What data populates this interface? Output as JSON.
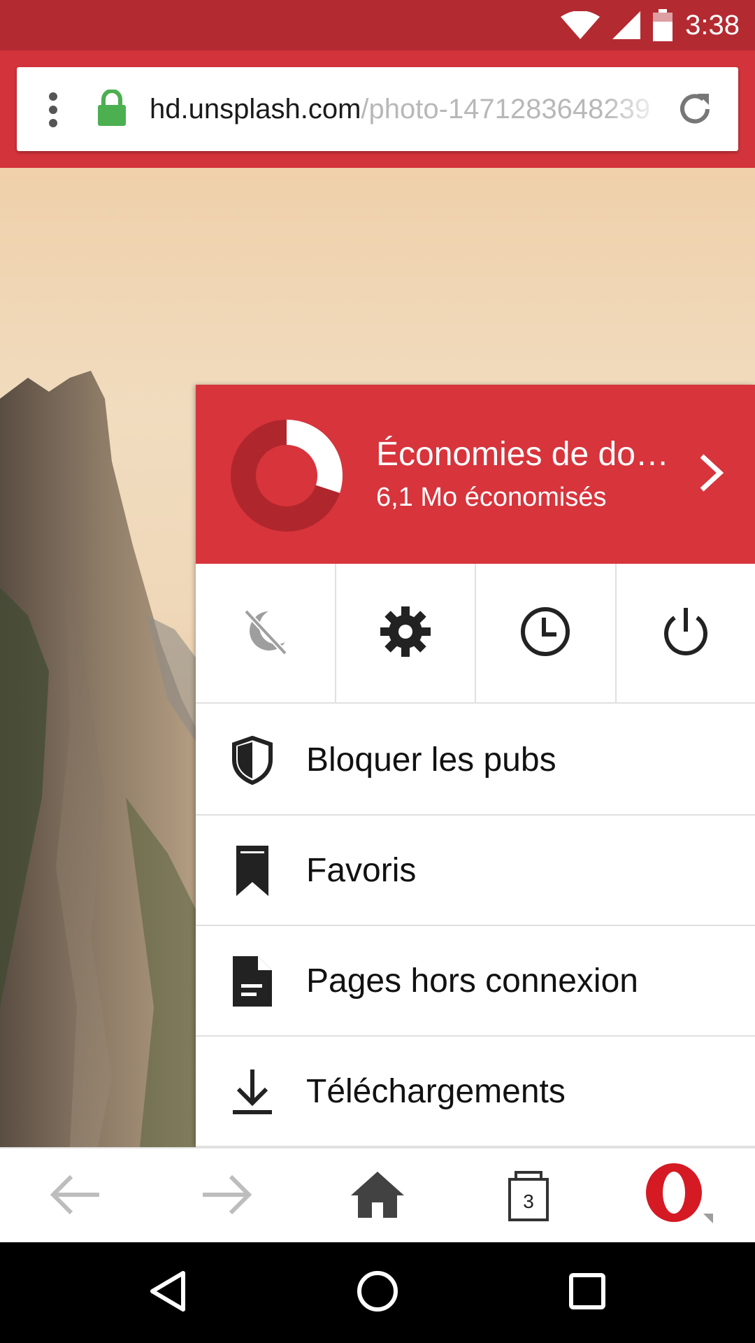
{
  "status_bar": {
    "time": "3:38",
    "icons": [
      "wifi-icon",
      "signal-icon",
      "battery-icon"
    ]
  },
  "address_bar": {
    "url_host": "hd.unsplash.com",
    "url_path": "/photo-1471283648239",
    "secure": true,
    "icons": [
      "menu-dots-icon",
      "lock-icon",
      "reload-icon"
    ]
  },
  "menu": {
    "savings": {
      "title": "Économies de do…",
      "subtitle": "6,1 Mo économisés",
      "progress_fraction": 0.3
    },
    "quick_actions": [
      {
        "icon": "night-mode-icon"
      },
      {
        "icon": "settings-gear-icon"
      },
      {
        "icon": "history-clock-icon"
      },
      {
        "icon": "power-exit-icon"
      }
    ],
    "items": [
      {
        "label": "Bloquer les pubs",
        "icon": "ad-block-shield-icon"
      },
      {
        "label": "Favoris",
        "icon": "bookmark-icon"
      },
      {
        "label": "Pages hors connexion",
        "icon": "offline-page-icon"
      },
      {
        "label": "Téléchargements",
        "icon": "download-icon"
      }
    ]
  },
  "bottom_bar": {
    "tab_count": "3",
    "icons": [
      "back-arrow-icon",
      "forward-arrow-icon",
      "home-icon",
      "tabs-icon",
      "opera-menu-icon"
    ]
  },
  "nav_bar": {
    "icons": [
      "nav-back-icon",
      "nav-home-icon",
      "nav-recents-icon"
    ]
  },
  "colors": {
    "status_bar": "#b42a31",
    "toolbar": "#d3333b",
    "savings_panel": "#d7343c",
    "lock_green": "#4caf50"
  }
}
